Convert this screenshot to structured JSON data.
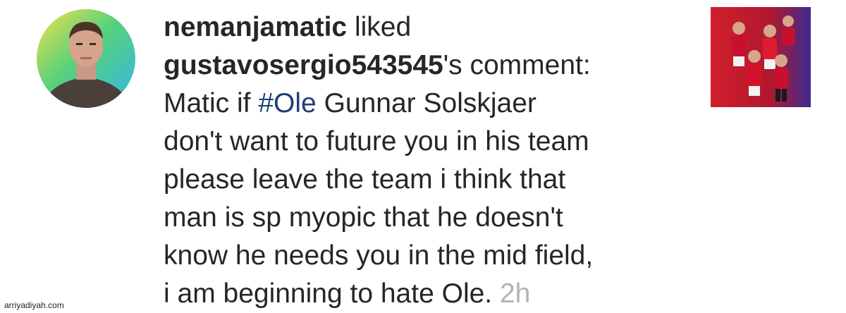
{
  "notification": {
    "actor_username": "nemanjamatic",
    "action_text": " liked",
    "commenter_username": "gustavosergio543545",
    "possessive_text": "'s comment:",
    "comment_line1_prefix": "Matic if ",
    "hashtag": "#Ole",
    "comment_line1_suffix": " Gunnar Solskjaer",
    "comment_line2": "don't want to future you in his team",
    "comment_line3": "please leave the team i think that",
    "comment_line4": "man is sp myopic that he doesn't",
    "comment_line5": "know he needs you in the mid field,",
    "comment_line6": "i am beginning to hate Ole.",
    "timestamp": "2h"
  },
  "watermark": {
    "text": "arriyadiyah.com"
  },
  "colors": {
    "text": "#262626",
    "hashtag": "#1e3f73",
    "timestamp": "#b3b3b3",
    "avatar_gradient": [
      "#f6e04c",
      "#58d27a",
      "#2fb7e8"
    ],
    "thumbnail_background": [
      "#d11f2b",
      "#3b2a8f"
    ]
  },
  "icons": {
    "avatar": "profile-avatar",
    "thumbnail": "post-thumbnail"
  }
}
